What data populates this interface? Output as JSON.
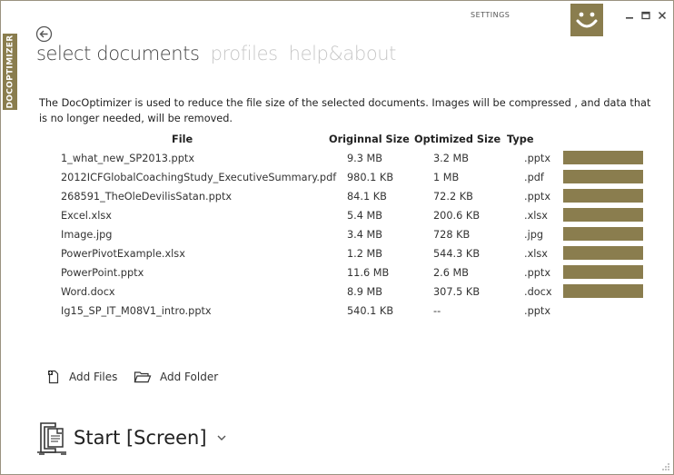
{
  "app": {
    "side_tab": "DOCOPTIMIZER",
    "settings_label": "SETTINGS",
    "accent_color": "#8a7d4e"
  },
  "nav": {
    "tabs": [
      {
        "label": "select documents",
        "active": true
      },
      {
        "label": "profiles",
        "active": false
      },
      {
        "label": "help&about",
        "active": false
      }
    ]
  },
  "description": "The DocOptimizer is used to reduce the file size of the selected documents. Images will be compressed , and data that is no longer needed, will be removed.",
  "table": {
    "headers": {
      "file": "File",
      "original": "Originnal Size",
      "optimized": "Optimized Size",
      "type": "Type"
    },
    "rows": [
      {
        "file": "1_what_new_SP2013.pptx",
        "original": "9.3 MB",
        "optimized": "3.2 MB",
        "type": ".pptx",
        "done": true
      },
      {
        "file": "2012ICFGlobalCoachingStudy_ExecutiveSummary.pdf",
        "original": "980.1 KB",
        "optimized": "1 MB",
        "type": ".pdf",
        "done": true
      },
      {
        "file": "268591_TheOleDevilisSatan.pptx",
        "original": "84.1 KB",
        "optimized": "72.2 KB",
        "type": ".pptx",
        "done": true
      },
      {
        "file": "Excel.xlsx",
        "original": "5.4 MB",
        "optimized": "200.6 KB",
        "type": ".xlsx",
        "done": true
      },
      {
        "file": "Image.jpg",
        "original": "3.4 MB",
        "optimized": "728 KB",
        "type": ".jpg",
        "done": true
      },
      {
        "file": "PowerPivotExample.xlsx",
        "original": "1.2 MB",
        "optimized": "544.3 KB",
        "type": ".xlsx",
        "done": true
      },
      {
        "file": "PowerPoint.pptx",
        "original": "11.6 MB",
        "optimized": "2.6 MB",
        "type": ".pptx",
        "done": true
      },
      {
        "file": "Word.docx",
        "original": "8.9 MB",
        "optimized": "307.5 KB",
        "type": ".docx",
        "done": true
      },
      {
        "file": "Ig15_SP_IT_M08V1_intro.pptx",
        "original": "540.1 KB",
        "optimized": "--",
        "type": ".pptx",
        "done": false
      }
    ]
  },
  "actions": {
    "add_files": "Add Files",
    "add_folder": "Add Folder",
    "start": "Start [Screen]"
  }
}
